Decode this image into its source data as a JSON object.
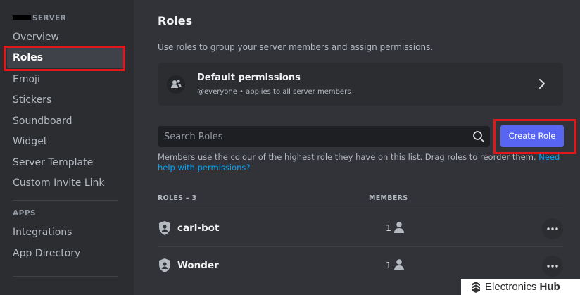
{
  "sidebar": {
    "server_heading": "SERVER",
    "items": [
      {
        "label": "Overview"
      },
      {
        "label": "Roles"
      },
      {
        "label": "Emoji"
      },
      {
        "label": "Stickers"
      },
      {
        "label": "Soundboard"
      },
      {
        "label": "Widget"
      },
      {
        "label": "Server Template"
      },
      {
        "label": "Custom Invite Link"
      }
    ],
    "apps_heading": "APPS",
    "apps_items": [
      {
        "label": "Integrations"
      },
      {
        "label": "App Directory"
      }
    ],
    "selected": "Roles"
  },
  "main": {
    "title": "Roles",
    "description": "Use roles to group your server members and assign permissions.",
    "default_permissions": {
      "title": "Default permissions",
      "subtitle": "@everyone • applies to all server members"
    },
    "search": {
      "placeholder": "Search Roles",
      "value": ""
    },
    "create_role_label": "Create Role",
    "helper_text": "Members use the colour of the highest role they have on this list. Drag roles to reorder them. ",
    "helper_link": "Need help with permissions?",
    "roles_header": "ROLES – 3",
    "members_header": "MEMBERS",
    "roles": [
      {
        "name": "carl-bot",
        "members": "1"
      },
      {
        "name": "Wonder",
        "members": "1"
      }
    ]
  },
  "watermark": {
    "brand": "Electronics",
    "brand_bold": "Hub"
  },
  "colors": {
    "accent": "#5865f2",
    "highlight": "#e3161c",
    "link": "#00a8fc",
    "background": "#313338",
    "sidebar": "#2b2d31"
  }
}
